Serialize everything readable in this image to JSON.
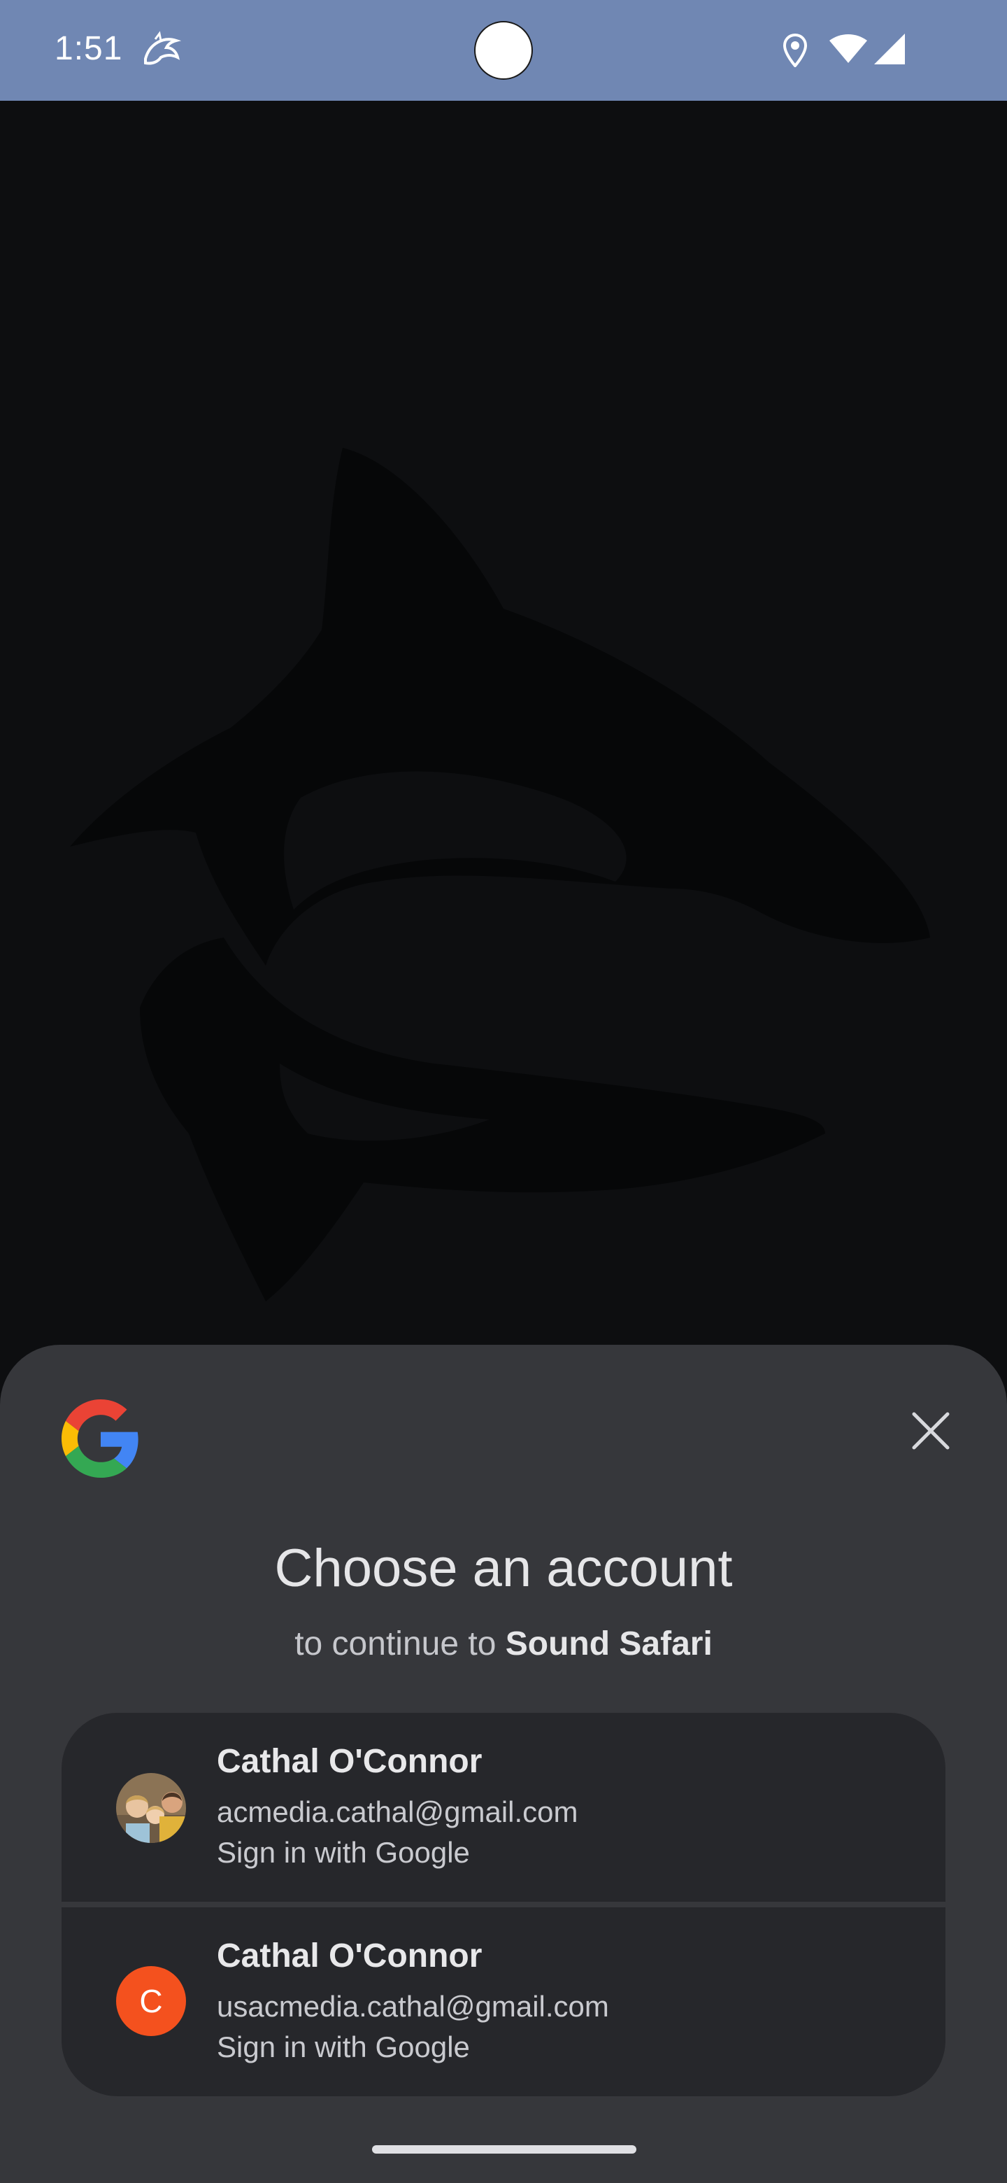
{
  "status_bar": {
    "time": "1:51",
    "icons": [
      "shark-app-icon",
      "location-icon",
      "wifi-icon",
      "cellular-signal-icon"
    ]
  },
  "background_app": {
    "logo": "shark-logo"
  },
  "sheet": {
    "provider_icon": "google-logo",
    "title": "Choose an account",
    "subtitle_prefix": "to continue to",
    "app_name": "Sound Safari",
    "accounts": [
      {
        "name": "Cathal O'Connor",
        "email": "acmedia.cathal@gmail.com",
        "action": "Sign in with Google",
        "avatar_type": "photo"
      },
      {
        "name": "Cathal O'Connor",
        "email": "usacmedia.cathal@gmail.com",
        "action": "Sign in with Google",
        "avatar_type": "initial",
        "avatar_initial": "C",
        "avatar_color": "#f4511e"
      }
    ]
  },
  "colors": {
    "status_bar": "#7087b3",
    "background": "#0d0e10",
    "sheet": "#36373b",
    "account_card": "#26272b"
  }
}
